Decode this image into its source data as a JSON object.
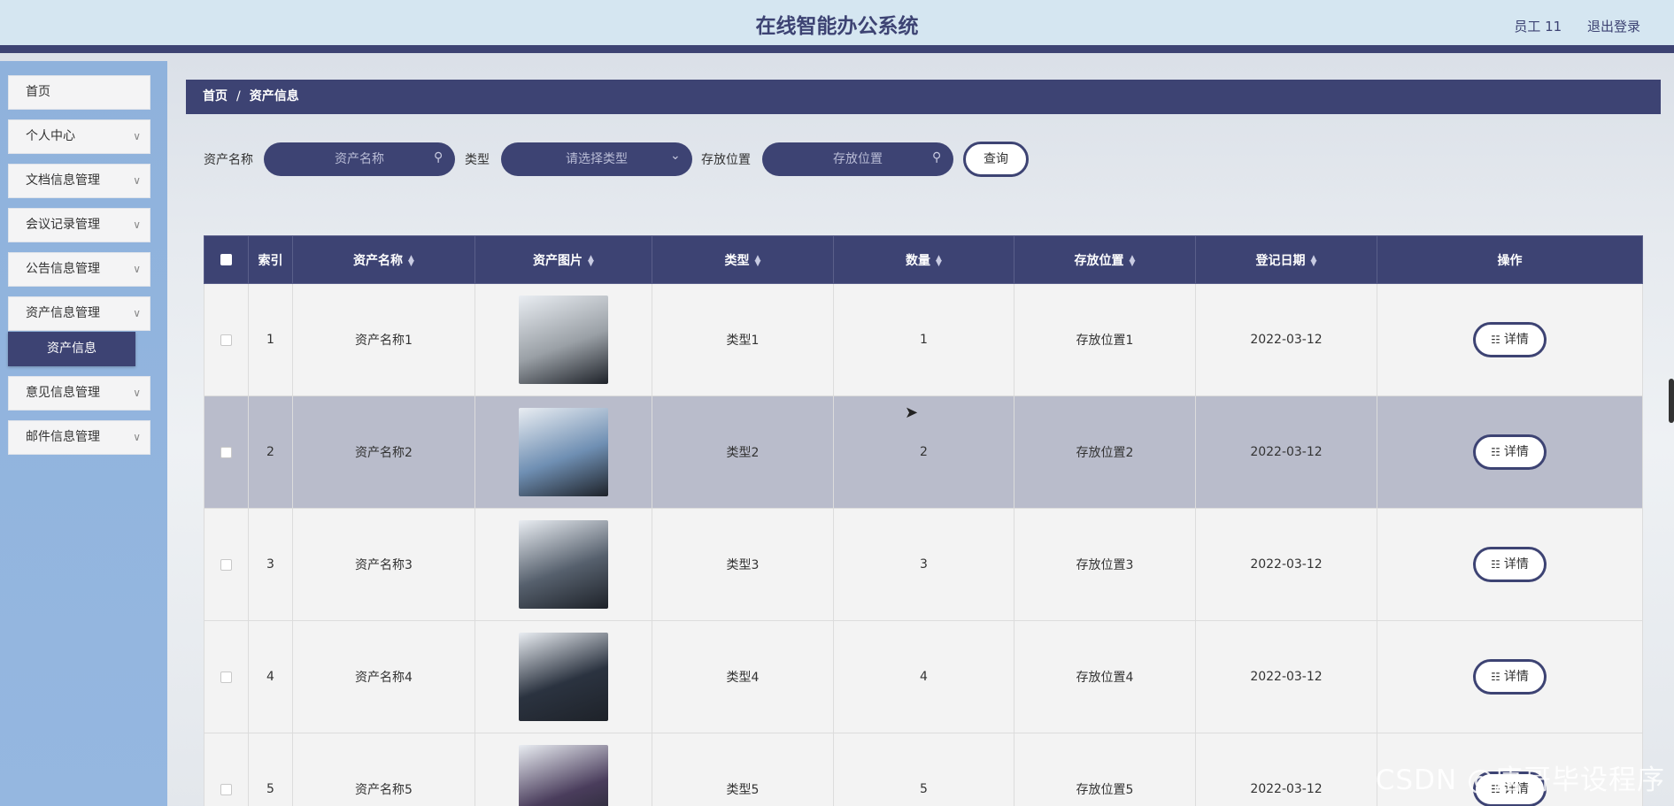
{
  "header": {
    "title": "在线智能办公系统",
    "user": "员工 11",
    "logout": "退出登录"
  },
  "sidebar": {
    "items": [
      {
        "label": "首页",
        "has_chevron": false
      },
      {
        "label": "个人中心",
        "has_chevron": true
      },
      {
        "label": "文档信息管理",
        "has_chevron": true
      },
      {
        "label": "会议记录管理",
        "has_chevron": true
      },
      {
        "label": "公告信息管理",
        "has_chevron": true
      },
      {
        "label": "资产信息管理",
        "has_chevron": true
      },
      {
        "label": "意见信息管理",
        "has_chevron": true
      },
      {
        "label": "邮件信息管理",
        "has_chevron": true
      }
    ],
    "active_sub": "资产信息"
  },
  "breadcrumb": {
    "home": "首页",
    "separator": "/",
    "current": "资产信息"
  },
  "search": {
    "name_label": "资产名称",
    "name_placeholder": "资产名称",
    "type_label": "类型",
    "type_placeholder": "请选择类型",
    "location_label": "存放位置",
    "location_placeholder": "存放位置",
    "query_button": "查询"
  },
  "table": {
    "headers": {
      "index": "索引",
      "name": "资产名称",
      "image": "资产图片",
      "type": "类型",
      "quantity": "数量",
      "location": "存放位置",
      "date": "登记日期",
      "action": "操作"
    },
    "detail_label": "详情",
    "rows": [
      {
        "index": "1",
        "name": "资产名称1",
        "type": "类型1",
        "quantity": "1",
        "location": "存放位置1",
        "date": "2022-03-12",
        "image_color": "#9aa0a6",
        "highlight": false
      },
      {
        "index": "2",
        "name": "资产名称2",
        "type": "类型2",
        "quantity": "2",
        "location": "存放位置2",
        "date": "2022-03-12",
        "image_color": "#6f8fb3",
        "highlight": true
      },
      {
        "index": "3",
        "name": "资产名称3",
        "type": "类型3",
        "quantity": "3",
        "location": "存放位置3",
        "date": "2022-03-12",
        "image_color": "#56606d",
        "highlight": false
      },
      {
        "index": "4",
        "name": "资产名称4",
        "type": "类型4",
        "quantity": "4",
        "location": "存放位置4",
        "date": "2022-03-12",
        "image_color": "#2b3340",
        "highlight": false
      },
      {
        "index": "5",
        "name": "资产名称5",
        "type": "类型5",
        "quantity": "5",
        "location": "存放位置5",
        "date": "2022-03-12",
        "image_color": "#4a3d5c",
        "highlight": false
      }
    ]
  },
  "watermark": "CSDN @唐哥毕设程序",
  "colors": {
    "primary": "#3d4373",
    "header_bg": "#d5e6f1",
    "sidebar_bg": "#8fb2dc",
    "row_highlight": "#b9bccb"
  }
}
